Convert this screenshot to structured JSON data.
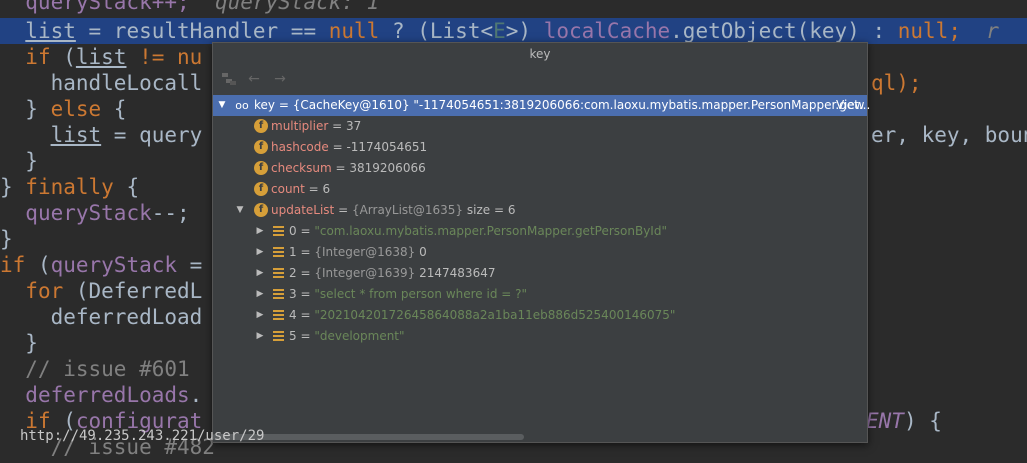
{
  "code": {
    "line0": {
      "a": "  queryStack++;",
      "b": "  queryStack: 1"
    },
    "line1": {
      "a": "  ",
      "list": "list",
      "b": " = resultHandler == ",
      "null1": "null",
      "c": " ? (List<",
      "e": "E",
      "d": ">) ",
      "lc": "localCache",
      "f": ".getObject(key) : ",
      "null2": "null",
      "g": ";  ",
      "r": "r"
    },
    "line2": {
      "a": "  ",
      "kw": "if",
      "b": " (",
      "list": "list",
      "c": " != nu"
    },
    "line2r": "ql);",
    "line3": "    handleLocall",
    "line4": {
      "a": "  } ",
      "kw": "else",
      "b": " {"
    },
    "line5": {
      "a": "    ",
      "list": "list",
      "b": " = query"
    },
    "line5r": "er, key, boun",
    "line6": "  }",
    "line7": {
      "a": "} ",
      "kw": "finally",
      "b": " {"
    },
    "line8": {
      "a": "  ",
      "f": "queryStack",
      "b": "--;"
    },
    "line9": "}",
    "line10": {
      "kw": "if",
      "a": " (",
      "f": "queryStack",
      "b": " ="
    },
    "line11": {
      "a": "  ",
      "kw": "for",
      "b": " (DeferredL"
    },
    "line12": "    deferredLoad",
    "line13": "  }",
    "line14": "  // issue #601",
    "line15": {
      "a": "  ",
      "f": "deferredLoads",
      "b": "."
    },
    "line16": {
      "a": "  ",
      "kw": "if",
      "b": " (",
      "f": "configurat"
    },
    "line16r": {
      "c": "ENT",
      "d": ") {"
    },
    "line17": "    // issue #482"
  },
  "popup": {
    "title": "key",
    "back_glyph": "←",
    "forward_glyph": "→",
    "rows": [
      {
        "name": "key",
        "eq": " = ",
        "ref": "{CacheKey@1610}",
        "val": " \"-1174054651:3819206066:com.laoxu.mybatis.mapper.PersonMapper.get...",
        "link": "View"
      },
      {
        "name": "multiplier",
        "val": " = 37"
      },
      {
        "name": "hashcode",
        "val": " = -1174054651"
      },
      {
        "name": "checksum",
        "val": " = 3819206066"
      },
      {
        "name": "count",
        "val": " = 6"
      },
      {
        "name": "updateList",
        "eq": " = ",
        "ref": "{ArrayList@1635}",
        "val": "  size = 6"
      },
      {
        "idx": "0",
        "eq": " = ",
        "sval": "\"com.laoxu.mybatis.mapper.PersonMapper.getPersonById\""
      },
      {
        "idx": "1",
        "eq": " = ",
        "ref": "{Integer@1638}",
        "val": " 0"
      },
      {
        "idx": "2",
        "eq": " = ",
        "ref": "{Integer@1639}",
        "val": " 2147483647"
      },
      {
        "idx": "3",
        "eq": " = ",
        "sval": "\"select * from person where id = ?\""
      },
      {
        "idx": "4",
        "eq": " = ",
        "sval": "\"20210420172645864088a2a1ba11eb886d525400146075\""
      },
      {
        "idx": "5",
        "eq": " = ",
        "sval": "\"development\""
      }
    ]
  },
  "watermark": "http://49.235.243.221/user/29",
  "colors": {
    "selection": "#4b6eaf",
    "field_icon": "#d69f39",
    "current_line": "#214283"
  }
}
